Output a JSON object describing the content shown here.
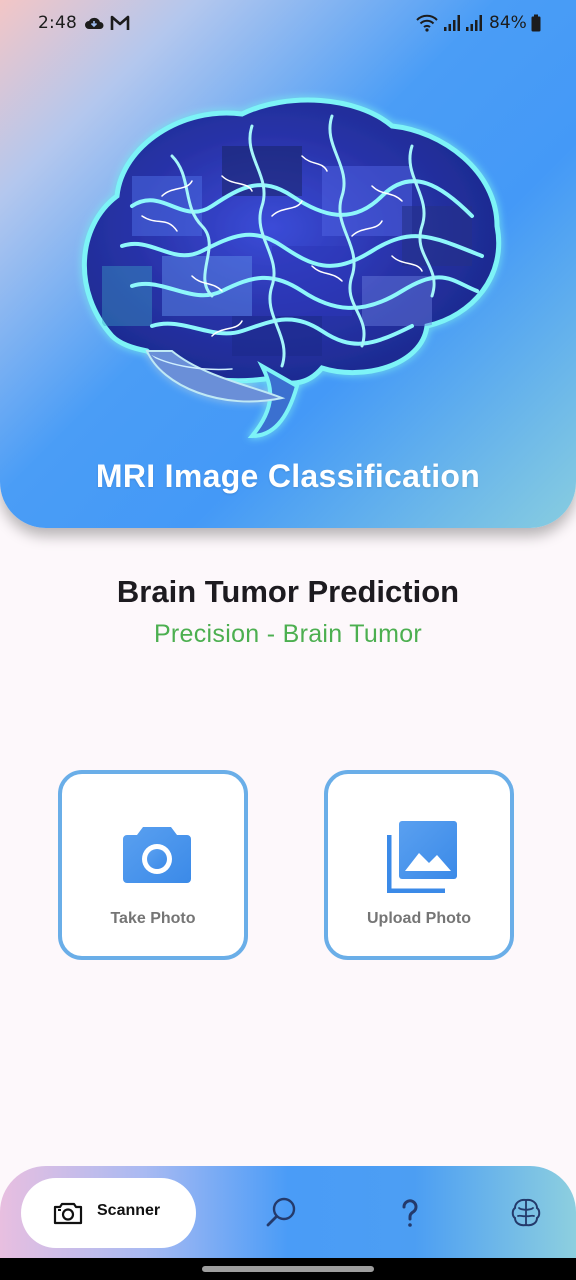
{
  "status_bar": {
    "time": "2:48",
    "battery": "84%"
  },
  "header": {
    "title": "MRI Image Classification",
    "image": "brain-illustration"
  },
  "main": {
    "title": "Brain Tumor Prediction",
    "subtitle": "Precision - Brain Tumor"
  },
  "actions": {
    "take_photo": {
      "label": "Take Photo",
      "icon": "camera-icon"
    },
    "upload_photo": {
      "label": "Upload Photo",
      "icon": "gallery-icon"
    }
  },
  "nav": {
    "active": {
      "label": "Scanner",
      "icon": "scanner-icon"
    },
    "items": [
      {
        "icon": "search-icon"
      },
      {
        "icon": "help-icon"
      },
      {
        "icon": "brain-icon"
      }
    ]
  },
  "colors": {
    "accent_blue": "#4a9df6",
    "subtitle_green": "#4caf50",
    "card_border": "#6aaee8"
  }
}
